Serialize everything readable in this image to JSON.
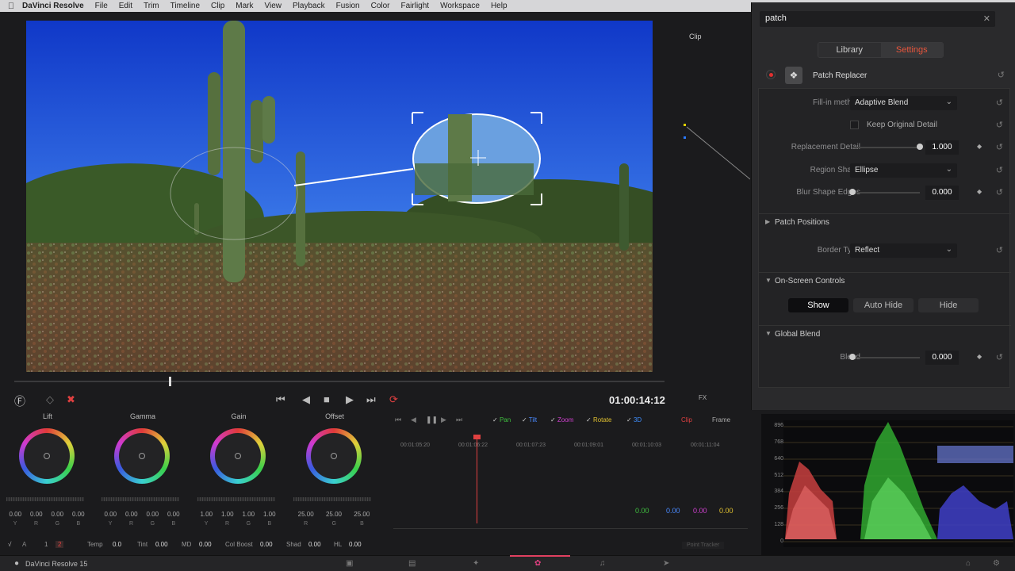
{
  "menubar": {
    "app": "DaVinci Resolve",
    "items": [
      "File",
      "Edit",
      "Trim",
      "Timeline",
      "Clip",
      "Mark",
      "View",
      "Playback",
      "Fusion",
      "Color",
      "Fairlight",
      "Workspace",
      "Help"
    ]
  },
  "node_label": "Clip",
  "timecode": "01:00:14:12",
  "wheels": [
    {
      "title": "Lift",
      "vals": [
        "0.00",
        "0.00",
        "0.00",
        "0.00"
      ],
      "chs": [
        "Y",
        "R",
        "G",
        "B"
      ]
    },
    {
      "title": "Gamma",
      "vals": [
        "0.00",
        "0.00",
        "0.00",
        "0.00"
      ],
      "chs": [
        "Y",
        "R",
        "G",
        "B"
      ]
    },
    {
      "title": "Gain",
      "vals": [
        "1.00",
        "1.00",
        "1.00",
        "1.00"
      ],
      "chs": [
        "Y",
        "R",
        "G",
        "B"
      ]
    },
    {
      "title": "Offset",
      "vals": [
        "25.00",
        "25.00",
        "25.00"
      ],
      "chs": [
        "R",
        "G",
        "B"
      ]
    }
  ],
  "wheel_bottom": {
    "page1": "1",
    "page2": "2",
    "temp_label": "Temp",
    "temp": "0.0",
    "tint_label": "Tint",
    "tint": "0.00",
    "md_label": "MD",
    "md": "0.00",
    "colboost_label": "Col Boost",
    "colboost": "0.00",
    "shad_label": "Shad",
    "shad": "0.00",
    "hl_label": "HL",
    "hl": "0.00"
  },
  "keyframe": {
    "checks": [
      {
        "label": "Pan",
        "color": "#3fbf3f"
      },
      {
        "label": "Tilt",
        "color": "#4a8aff"
      },
      {
        "label": "Zoom",
        "color": "#d040d0"
      },
      {
        "label": "Rotate",
        "color": "#e0c030"
      },
      {
        "label": "3D",
        "color": "#3f8fff"
      }
    ],
    "clip_btn": "Clip",
    "frame_btn": "Frame",
    "timecodes": [
      "00:01:05:20",
      "00:01:06:22",
      "00:01:07:23",
      "00:01:09:01",
      "00:01:10:03",
      "00:01:11:04"
    ],
    "values": [
      "0.00",
      "0.00",
      "0.00",
      "0.00"
    ],
    "value_colors": [
      "#3fbf3f",
      "#4a8aff",
      "#d040d0",
      "#e0c030"
    ],
    "tracker_label": "Point Tracker",
    "fx_label": "FX"
  },
  "openfx": {
    "search": "patch",
    "tabs": [
      "Library",
      "Settings"
    ],
    "active_tab": "Settings",
    "accent": "#e8553c",
    "plugin": "Patch Replacer",
    "fill_label": "Fill-in method",
    "fill_value": "Adaptive Blend",
    "keep_label": "Keep Original Detail",
    "repl_label": "Replacement Detail",
    "repl_value": "1.000",
    "repl_level": 1.0,
    "shape_label": "Region Shape",
    "shape_value": "Ellipse",
    "blur_label": "Blur Shape Edges",
    "blur_value": "0.000",
    "blur_level": 0.0,
    "patch_positions": "Patch Positions",
    "border_label": "Border Type",
    "border_value": "Reflect",
    "osc_title": "On-Screen Controls",
    "osc_buttons": [
      "Show",
      "Auto Hide",
      "Hide"
    ],
    "osc_active": "Show",
    "global_title": "Global Blend",
    "blend_label": "Blend",
    "blend_value": "0.000",
    "blend_level": 0.0
  },
  "scopes": {
    "labels": [
      "896",
      "768",
      "640",
      "512",
      "384",
      "256",
      "128",
      "0"
    ]
  },
  "status": {
    "name": "DaVinci Resolve 15"
  }
}
